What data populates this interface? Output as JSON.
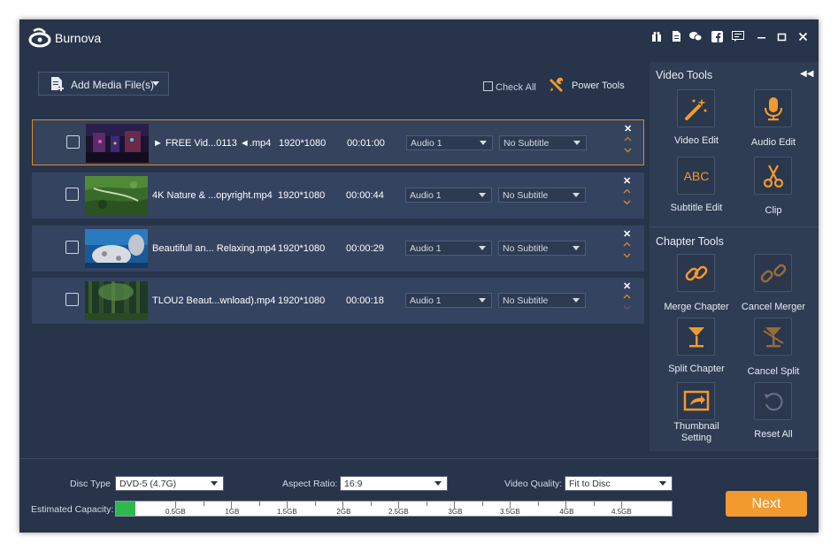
{
  "app": {
    "title": "Burnova"
  },
  "toolbar": {
    "add_media_label": "Add Media File(s)",
    "check_all_label": "Check All",
    "power_tools_label": "Power Tools"
  },
  "files": [
    {
      "name": "► FREE Vid...0113 ◄.mp4",
      "resolution": "1920*1080",
      "duration": "00:01:00",
      "audio": "Audio 1",
      "subtitle": "No Subtitle"
    },
    {
      "name": "4K Nature & ...opyright.mp4",
      "resolution": "1920*1080",
      "duration": "00:00:44",
      "audio": "Audio 1",
      "subtitle": "No Subtitle"
    },
    {
      "name": "Beautifull an... Relaxing.mp4",
      "resolution": "1920*1080",
      "duration": "00:00:29",
      "audio": "Audio 1",
      "subtitle": "No Subtitle"
    },
    {
      "name": "TLOU2 Beaut...wnload).mp4",
      "resolution": "1920*1080",
      "duration": "00:00:18",
      "audio": "Audio 1",
      "subtitle": "No Subtitle"
    }
  ],
  "video_tools": {
    "title": "Video Tools",
    "items": [
      {
        "label": "Video Edit",
        "icon": "magic-wand-icon"
      },
      {
        "label": "Audio Edit",
        "icon": "microphone-icon"
      },
      {
        "label": "Subtitle Edit",
        "icon": "abc-icon"
      },
      {
        "label": "Clip",
        "icon": "scissors-icon"
      }
    ]
  },
  "chapter_tools": {
    "title": "Chapter Tools",
    "items": [
      {
        "label": "Merge Chapter",
        "icon": "chain-link-icon"
      },
      {
        "label": "Cancel Merger",
        "icon": "broken-link-icon"
      },
      {
        "label": "Split Chapter",
        "icon": "split-icon"
      },
      {
        "label": "Cancel Split",
        "icon": "cancel-split-icon"
      },
      {
        "label": "Thumbnail Setting",
        "label_line1": "Thumbnail",
        "label_line2": "Setting",
        "icon": "thumbnail-icon"
      },
      {
        "label": "Reset All",
        "icon": "reset-icon"
      }
    ]
  },
  "bottom": {
    "disc_type_label": "Disc Type",
    "disc_type_value": "DVD-5 (4.7G)",
    "aspect_ratio_label": "Aspect Ratio:",
    "aspect_ratio_value": "16:9",
    "video_quality_label": "Video Quality:",
    "video_quality_value": "Fit to Disc",
    "capacity_label": "Estimated Capacity:",
    "capacity_ticks": [
      "0.5GB",
      "1GB",
      "1.5GB",
      "2GB",
      "2.5GB",
      "3GB",
      "3.5GB",
      "4GB",
      "4.5GB"
    ],
    "capacity_used_gb": 0.17,
    "capacity_max_gb": 4.7
  },
  "next_label": "Next",
  "colors": {
    "accent": "#f29a2e",
    "background": "#27344a",
    "capacity_fill": "#2fb84e"
  }
}
